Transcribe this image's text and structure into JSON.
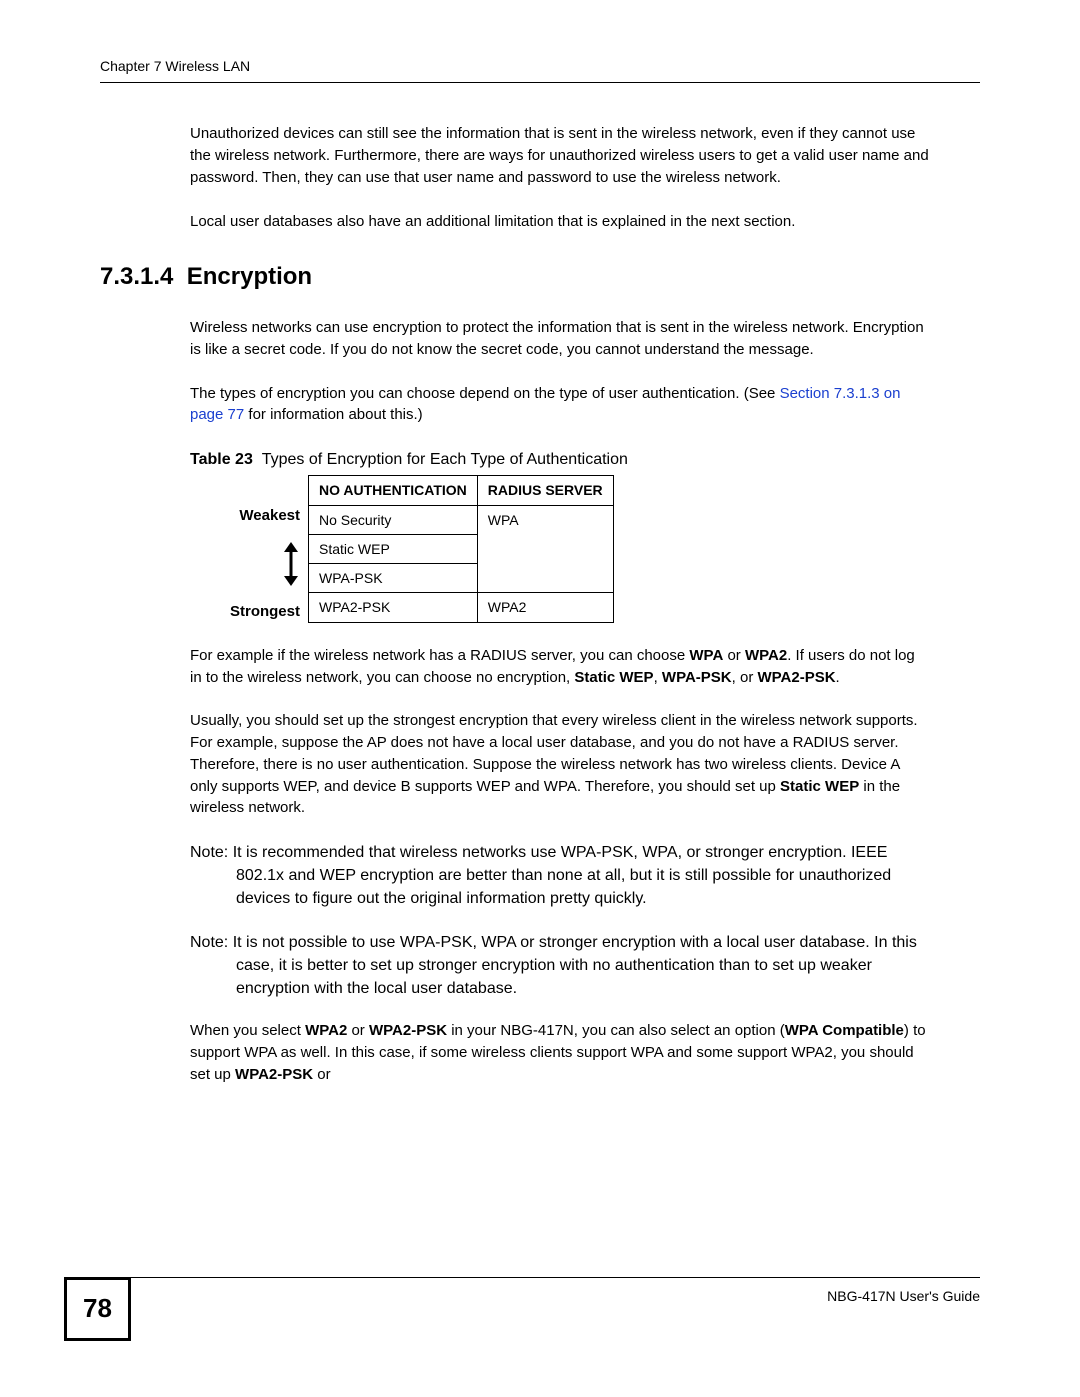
{
  "chapter_header": "Chapter 7 Wireless LAN",
  "intro": {
    "p1": "Unauthorized devices can still see the information that is sent in the wireless network, even if they cannot use the wireless network. Furthermore, there are ways for unauthorized wireless users to get a valid user name and password. Then, they can use that user name and password to use the wireless network.",
    "p2": "Local user databases also have an additional limitation that is explained in the next section."
  },
  "section": {
    "number": "7.3.1.4",
    "title": "Encryption"
  },
  "enc": {
    "p1": "Wireless networks can use encryption to protect the information that is sent in the wireless network. Encryption is like a secret code. If you do not know the secret code, you cannot understand the message.",
    "p2_pre": "The types of encryption you can choose depend on the type of user authentication. (See ",
    "p2_link": "Section 7.3.1.3 on page 77",
    "p2_post": " for information about this.)"
  },
  "table": {
    "caption_label": "Table 23",
    "caption_title": "Types of Encryption for Each Type of Authentication",
    "col1": "NO AUTHENTICATION",
    "col2": "RADIUS SERVER",
    "weakest": "Weakest",
    "strongest": "Strongest",
    "r1c1": "No Security",
    "r1c2": "WPA",
    "r2c1": "Static WEP",
    "r3c1": "WPA-PSK",
    "r4c1": "WPA2-PSK",
    "r4c2": "WPA2"
  },
  "after": {
    "p3_a": "For example if the wireless network has a RADIUS server, you can choose ",
    "p3_b": "WPA",
    "p3_c": " or ",
    "p3_d": "WPA2",
    "p3_e": ". If users do not log in to the wireless network, you can choose no encryption, ",
    "p3_f": "Static WEP",
    "p3_g": ", ",
    "p3_h": "WPA-PSK",
    "p3_i": ", or ",
    "p3_j": "WPA2-PSK",
    "p3_k": ".",
    "p4_a": "Usually, you should set up the strongest encryption that every wireless client in the wireless network supports. For example, suppose the AP does not have a local user database, and you do not have a RADIUS server. Therefore, there is no user authentication. Suppose the wireless network has two wireless clients. Device A only supports WEP, and device B supports WEP and WPA. Therefore, you should set up ",
    "p4_b": "Static WEP",
    "p4_c": " in the wireless network.",
    "note1": "Note: It is recommended that wireless networks use WPA-PSK, WPA, or stronger encryption. IEEE 802.1x and WEP encryption are better than none at all, but it is still possible for unauthorized devices to figure out the original information pretty quickly.",
    "note2": "Note: It is not possible to use WPA-PSK, WPA or stronger encryption with a local user database. In this case, it is better to set up stronger encryption with no authentication than to set up weaker encryption with the local user database.",
    "p5_a": "When you select ",
    "p5_b": "WPA2",
    "p5_c": " or ",
    "p5_d": "WPA2-PSK",
    "p5_e": " in your NBG-417N, you can also select an option (",
    "p5_f": "WPA Compatible",
    "p5_g": ") to support WPA as well. In this case, if some wireless clients support WPA and some support WPA2, you should set up ",
    "p5_h": "WPA2-PSK",
    "p5_i": " or"
  },
  "footer": {
    "page": "78",
    "guide": "NBG-417N User's Guide"
  }
}
